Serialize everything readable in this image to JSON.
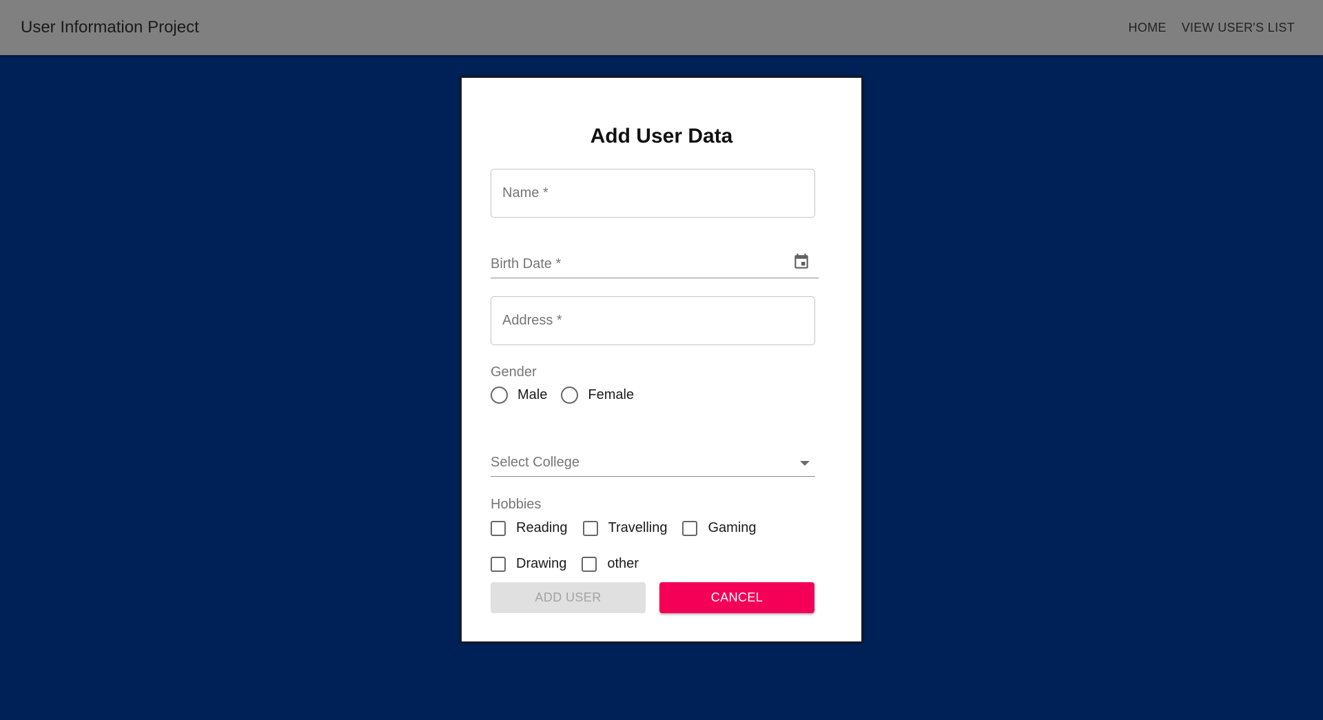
{
  "header": {
    "title": "User Information Project",
    "nav": [
      "HOME",
      "VIEW USER'S LIST"
    ]
  },
  "form": {
    "title": "Add User Data",
    "name_label": "Name *",
    "birth_date_label": "Birth Date *",
    "address_label": "Address *",
    "gender": {
      "label": "Gender",
      "options": [
        "Male",
        "Female"
      ]
    },
    "college": {
      "placeholder": "Select College"
    },
    "hobbies": {
      "label": "Hobbies",
      "options": [
        "Reading",
        "Travelling",
        "Gaming",
        "Drawing",
        "other"
      ]
    },
    "add_button": "ADD USER",
    "cancel_button": "CANCEL"
  },
  "colors": {
    "background": "#002157",
    "appbar": "#808080",
    "cancel": "#f50057",
    "disabled": "#e0e0e0"
  },
  "icons": {
    "birth_date": "calendar-icon",
    "college": "chevron-down-icon"
  }
}
